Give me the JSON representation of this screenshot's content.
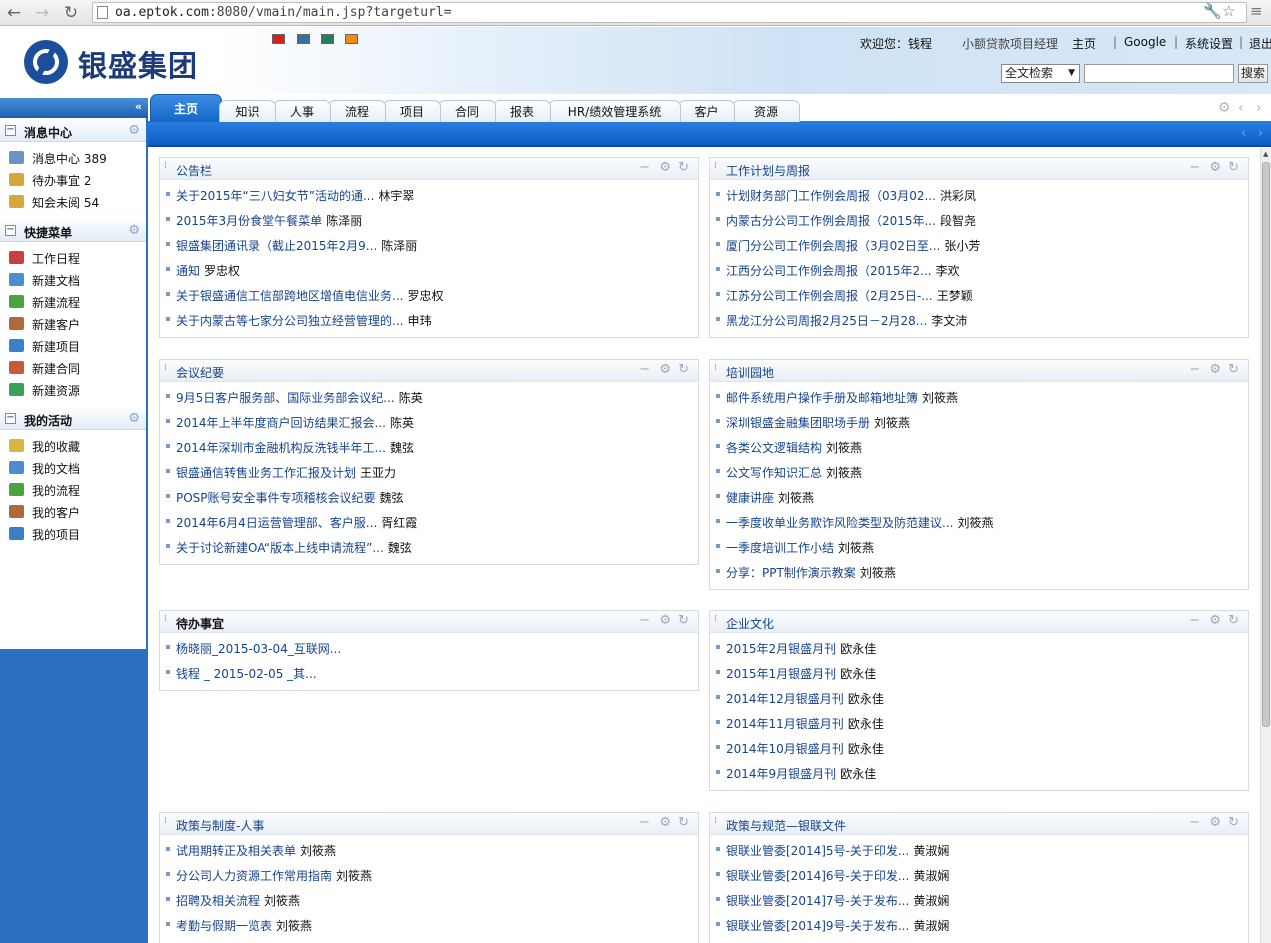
{
  "browser": {
    "url_host": "oa.eptok.com",
    "url_rest": ":8080/vmain/main.jsp?targeturl="
  },
  "header": {
    "logo_text": "银盛集团",
    "welcome": "欢迎您：钱程",
    "role": "小额贷款项目经理",
    "links": [
      "主页",
      "Google",
      "系统设置",
      "退出"
    ],
    "separator": "|",
    "search_scope": "全文检索",
    "search_value": "",
    "search_button": "搜索",
    "theme_colors": [
      "#d42020",
      "#3d6f9e",
      "#2d7a5a",
      "#f08a10"
    ]
  },
  "sidebar": {
    "collapse_icon": "«",
    "sections": [
      {
        "title": "消息中心",
        "items": [
          {
            "label": "消息中心 389",
            "icon": "mail-icon",
            "color": "#6c93c5"
          },
          {
            "label": "待办事宜 2",
            "icon": "pencil-note-icon",
            "color": "#d8a73a"
          },
          {
            "label": "知会未阅 54",
            "icon": "pencil-note-icon",
            "color": "#d8a73a"
          }
        ]
      },
      {
        "title": "快捷菜单",
        "items": [
          {
            "label": "工作日程",
            "icon": "calendar-icon",
            "color": "#c94040"
          },
          {
            "label": "新建文档",
            "icon": "new-document-icon",
            "color": "#4a8ecf"
          },
          {
            "label": "新建流程",
            "icon": "new-flow-icon",
            "color": "#49a43d"
          },
          {
            "label": "新建客户",
            "icon": "new-customer-icon",
            "color": "#b06a3a"
          },
          {
            "label": "新建项目",
            "icon": "new-project-icon",
            "color": "#3b7fc8"
          },
          {
            "label": "新建合同",
            "icon": "new-contract-icon",
            "color": "#c85a3a"
          },
          {
            "label": "新建资源",
            "icon": "new-resource-icon",
            "color": "#3aa05a"
          }
        ]
      },
      {
        "title": "我的活动",
        "items": [
          {
            "label": "我的收藏",
            "icon": "favorites-folder-icon",
            "color": "#d8b540"
          },
          {
            "label": "我的文档",
            "icon": "document-icon",
            "color": "#4a8ecf"
          },
          {
            "label": "我的流程",
            "icon": "flow-icon",
            "color": "#49a43d"
          },
          {
            "label": "我的客户",
            "icon": "customer-icon",
            "color": "#b06a3a"
          },
          {
            "label": "我的项目",
            "icon": "project-icon",
            "color": "#3b7fc8"
          }
        ]
      }
    ]
  },
  "tabs": [
    "主页",
    "知识",
    "人事",
    "流程",
    "项目",
    "合同",
    "报表",
    "HR/绩效管理系统",
    "客户",
    "资源"
  ],
  "portlets": [
    {
      "title": "公告栏",
      "items": [
        {
          "text": "关于2015年“三八妇女节”活动的通...",
          "author": "林宇翠"
        },
        {
          "text": "2015年3月份食堂午餐菜单",
          "author": "陈泽丽"
        },
        {
          "text": "银盛集团通讯录（截止2015年2月9...",
          "author": "陈泽丽"
        },
        {
          "text": "通知",
          "author": "罗忠权"
        },
        {
          "text": "关于银盛通信工信部跨地区增值电信业务...",
          "author": "罗忠权"
        },
        {
          "text": "关于内蒙古等七家分公司独立经营管理的...",
          "author": "申玮"
        }
      ]
    },
    {
      "title": "工作计划与周报",
      "items": [
        {
          "text": "计划财务部门工作例会周报（03月02...",
          "author": "洪彩凤"
        },
        {
          "text": "内蒙古分公司工作例会周报（2015年...",
          "author": "段智尧"
        },
        {
          "text": "厦门分公司工作例会周报（3月02日至...",
          "author": "张小芳"
        },
        {
          "text": "江西分公司工作例会周报（2015年2...",
          "author": "李欢"
        },
        {
          "text": "江苏分公司工作例会周报（2月25日-...",
          "author": "王梦颖"
        },
        {
          "text": "黑龙江分公司周报2月25日－2月28...",
          "author": "李文沛"
        }
      ]
    },
    {
      "title": "会议纪要",
      "items": [
        {
          "text": "9月5日客户服务部、国际业务部会议纪...",
          "author": "陈英"
        },
        {
          "text": "2014年上半年度商户回访结果汇报会...",
          "author": "陈英"
        },
        {
          "text": "2014年深圳市金融机构反洗钱半年工...",
          "author": "魏弦"
        },
        {
          "text": "银盛通信转售业务工作汇报及计划",
          "author": "王亚力"
        },
        {
          "text": "POSP账号安全事件专项稽核会议纪要",
          "author": "魏弦"
        },
        {
          "text": "2014年6月4日运营管理部、客户服...",
          "author": "胥红霞"
        },
        {
          "text": "关于讨论新建OA“版本上线申请流程”...",
          "author": "魏弦"
        }
      ]
    },
    {
      "title": "培训园地",
      "items": [
        {
          "text": "邮件系统用户操作手册及邮箱地址簿",
          "author": "刘筱燕"
        },
        {
          "text": "深圳银盛金融集团职场手册",
          "author": "刘筱燕"
        },
        {
          "text": "各类公文逻辑结构",
          "author": "刘筱燕"
        },
        {
          "text": "公文写作知识汇总",
          "author": "刘筱燕"
        },
        {
          "text": "健康讲座",
          "author": "刘筱燕"
        },
        {
          "text": "一季度收单业务欺诈风险类型及防范建议...",
          "author": "刘筱燕"
        },
        {
          "text": "一季度培训工作小结",
          "author": "刘筱燕"
        },
        {
          "text": "分享：PPT制作演示教案",
          "author": "刘筱燕"
        }
      ]
    },
    {
      "title": "待办事宜",
      "items": [
        {
          "text": "杨晓丽_2015-03-04_互联网...",
          "author": ""
        },
        {
          "text": "钱程 _ 2015-02-05 _其...",
          "author": ""
        }
      ]
    },
    {
      "title": "企业文化",
      "items": [
        {
          "text": "2015年2月银盛月刊",
          "author": "欧永佳"
        },
        {
          "text": "2015年1月银盛月刊",
          "author": "欧永佳"
        },
        {
          "text": "2014年12月银盛月刊",
          "author": "欧永佳"
        },
        {
          "text": "2014年11月银盛月刊",
          "author": "欧永佳"
        },
        {
          "text": "2014年10月银盛月刊",
          "author": "欧永佳"
        },
        {
          "text": "2014年9月银盛月刊",
          "author": "欧永佳"
        }
      ]
    },
    {
      "title": "政策与制度-人事",
      "items": [
        {
          "text": "试用期转正及相关表单",
          "author": "刘筱燕"
        },
        {
          "text": "分公司人力资源工作常用指南",
          "author": "刘筱燕"
        },
        {
          "text": "招聘及相关流程",
          "author": "刘筱燕"
        },
        {
          "text": "考勤与假期一览表",
          "author": "刘筱燕"
        }
      ]
    },
    {
      "title": "政策与规范—银联文件",
      "items": [
        {
          "text": "银联业管委[2014]5号-关于印发...",
          "author": "黄淑娴"
        },
        {
          "text": "银联业管委[2014]6号-关于印发...",
          "author": "黄淑娴"
        },
        {
          "text": "银联业管委[2014]7号-关于发布...",
          "author": "黄淑娴"
        },
        {
          "text": "银联业管委[2014]9号-关于发布...",
          "author": "黄淑娴"
        }
      ]
    }
  ]
}
